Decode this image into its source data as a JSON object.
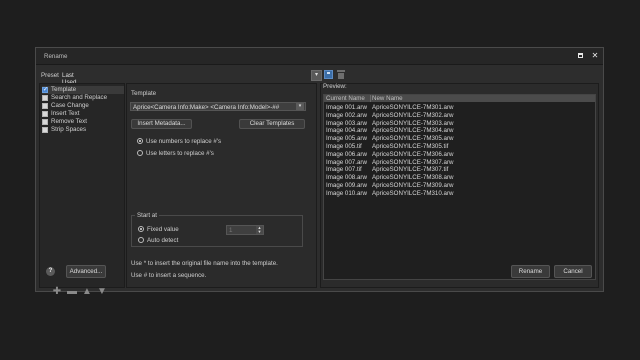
{
  "window": {
    "title": "Rename",
    "maximize_icon": "maximize-icon",
    "close_label": "✕"
  },
  "preset": {
    "label": "Preset",
    "value": "Last Used Settings"
  },
  "actions": [
    {
      "label": "Template",
      "checked": true
    },
    {
      "label": "Search and Replace",
      "checked": false
    },
    {
      "label": "Case Change",
      "checked": false
    },
    {
      "label": "Insert Text",
      "checked": false
    },
    {
      "label": "Remove Text",
      "checked": false
    },
    {
      "label": "Strip Spaces",
      "checked": false
    }
  ],
  "template": {
    "label": "Template",
    "value": "Aprice<Camera Info:Make> <Camera Info:Model>-##",
    "insert_metadata": "Insert Metadata...",
    "clear_templates": "Clear Templates",
    "radio_numbers": "Use numbers to replace #'s",
    "radio_letters": "Use letters to replace #'s",
    "start_at": {
      "legend": "Start at",
      "fixed_value": "Fixed value",
      "auto_detect": "Auto detect",
      "number_value": "1"
    },
    "help1": "Use * to insert the original file name into the template.",
    "help2": "Use # to insert a sequence."
  },
  "preview": {
    "label": "Preview:",
    "columns": [
      "Current Name",
      "New Name"
    ],
    "rows": [
      [
        "Image 001.arw",
        "ApriceSONYILCE-7M301.arw"
      ],
      [
        "Image 002.arw",
        "ApriceSONYILCE-7M302.arw"
      ],
      [
        "Image 003.arw",
        "ApriceSONYILCE-7M303.arw"
      ],
      [
        "Image 004.arw",
        "ApriceSONYILCE-7M304.arw"
      ],
      [
        "Image 005.arw",
        "ApriceSONYILCE-7M305.arw"
      ],
      [
        "Image 005.tif",
        "ApriceSONYILCE-7M305.tif"
      ],
      [
        "Image 006.arw",
        "ApriceSONYILCE-7M306.arw"
      ],
      [
        "Image 007.arw",
        "ApriceSONYILCE-7M307.arw"
      ],
      [
        "Image 007.tif",
        "ApriceSONYILCE-7M307.tif"
      ],
      [
        "Image 008.arw",
        "ApriceSONYILCE-7M308.arw"
      ],
      [
        "Image 009.arw",
        "ApriceSONYILCE-7M309.arw"
      ],
      [
        "Image 010.arw",
        "ApriceSONYILCE-7M310.arw"
      ]
    ]
  },
  "footer": {
    "advanced": "Advanced...",
    "rename": "Rename",
    "cancel": "Cancel",
    "help_glyph": "?"
  }
}
